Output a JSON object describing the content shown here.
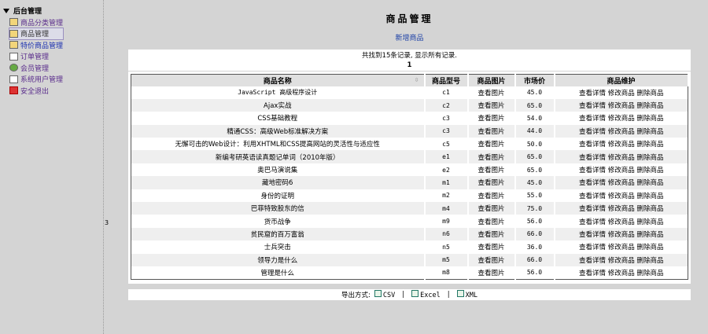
{
  "sidebar": {
    "root": "后台管理",
    "items": [
      {
        "label": "商品分类管理",
        "icon": "edit-icon"
      },
      {
        "label": "商品管理",
        "icon": "window-icon"
      },
      {
        "label": "特价商品管理",
        "icon": "window-icon"
      },
      {
        "label": "订单管理",
        "icon": "list-icon"
      },
      {
        "label": "会员管理",
        "icon": "users-icon"
      },
      {
        "label": "系统用户管理",
        "icon": "user-icon"
      },
      {
        "label": "安全退出",
        "icon": "close-icon"
      }
    ]
  },
  "page_marker": "3",
  "main": {
    "title": "商品管理",
    "add_link": "新增商品",
    "summary": "共找到15条记录, 显示所有记录.",
    "page": "1"
  },
  "table": {
    "headers": [
      "商品名称",
      "商品型号",
      "商品图片",
      "市场价",
      "商品维护"
    ],
    "view_pic": "查看图片",
    "actions": [
      "查看详情",
      "修改商品",
      "删除商品"
    ],
    "rows": [
      [
        "JavaScript 高级程序设计",
        "c1",
        "45.0"
      ],
      [
        "Ajax实战",
        "c2",
        "65.0"
      ],
      [
        "CSS基础教程",
        "c3",
        "54.0"
      ],
      [
        "精通CSS：高级Web标准解决方案",
        "c3",
        "44.0"
      ],
      [
        "无懈可击的Web设计：利用XHTML和CSS提高网站的灵活性与适应性",
        "c5",
        "50.0"
      ],
      [
        "新编考研英语读真题记单词（2010年版）",
        "e1",
        "65.0"
      ],
      [
        "奥巴马演说集",
        "e2",
        "65.0"
      ],
      [
        "藏地密码6",
        "m1",
        "45.0"
      ],
      [
        "身份的证明",
        "m2",
        "55.0"
      ],
      [
        "巴菲特致股东的信",
        "m4",
        "75.0"
      ],
      [
        "货币战争",
        "m9",
        "56.0"
      ],
      [
        "贫民窟的百万富翁",
        "n6",
        "66.0"
      ],
      [
        "士兵突击",
        "n5",
        "36.0"
      ],
      [
        "领导力是什么",
        "m5",
        "66.0"
      ],
      [
        "管理是什么",
        "m8",
        "56.0"
      ]
    ]
  },
  "export": {
    "label": "导出方式:",
    "csv": "CSV",
    "excel": "Excel",
    "xml": "XML",
    "sep": "|"
  }
}
